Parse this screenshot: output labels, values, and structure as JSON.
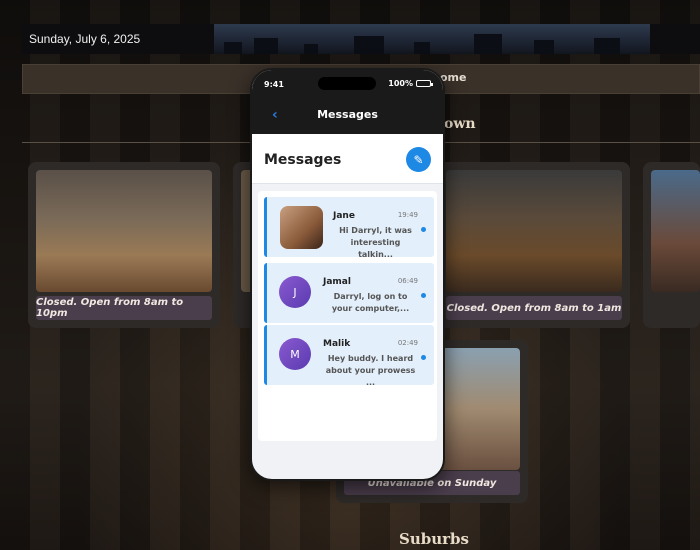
{
  "header": {
    "date": "Sunday, July 6, 2025",
    "nav_text": "ome",
    "section_title": "own"
  },
  "cards": [
    {
      "caption": "Closed. Open from 8am to 10pm",
      "image": "gym"
    },
    {
      "caption": "Closed. Open from 8am to 1am",
      "image": "bar"
    },
    {
      "caption": "Unavailable on Sunday",
      "image": "mall"
    }
  ],
  "bottom_section": "Suburbs",
  "phone": {
    "time": "9:41",
    "battery": "100%",
    "nav_title": "Messages",
    "back_icon": "chevron-left-icon",
    "header_title": "Messages",
    "compose_icon": "pencil-icon",
    "messages": [
      {
        "name": "Jane",
        "time": "19:49",
        "text": "Hi Darryl, it was interesting talkin...",
        "avatar": "photo",
        "initial": ""
      },
      {
        "name": "Jamal",
        "time": "06:49",
        "text": "Darryl, log on to your computer,...",
        "avatar": "purple",
        "initial": "J"
      },
      {
        "name": "Malik",
        "time": "02:49",
        "text": "Hey buddy. I heard about your prowess ...",
        "avatar": "purple",
        "initial": "M"
      }
    ]
  },
  "colors": {
    "accent": "#1e88e5",
    "unread_bg": "#e3effb",
    "caption_bg": "#4a3d4c"
  }
}
